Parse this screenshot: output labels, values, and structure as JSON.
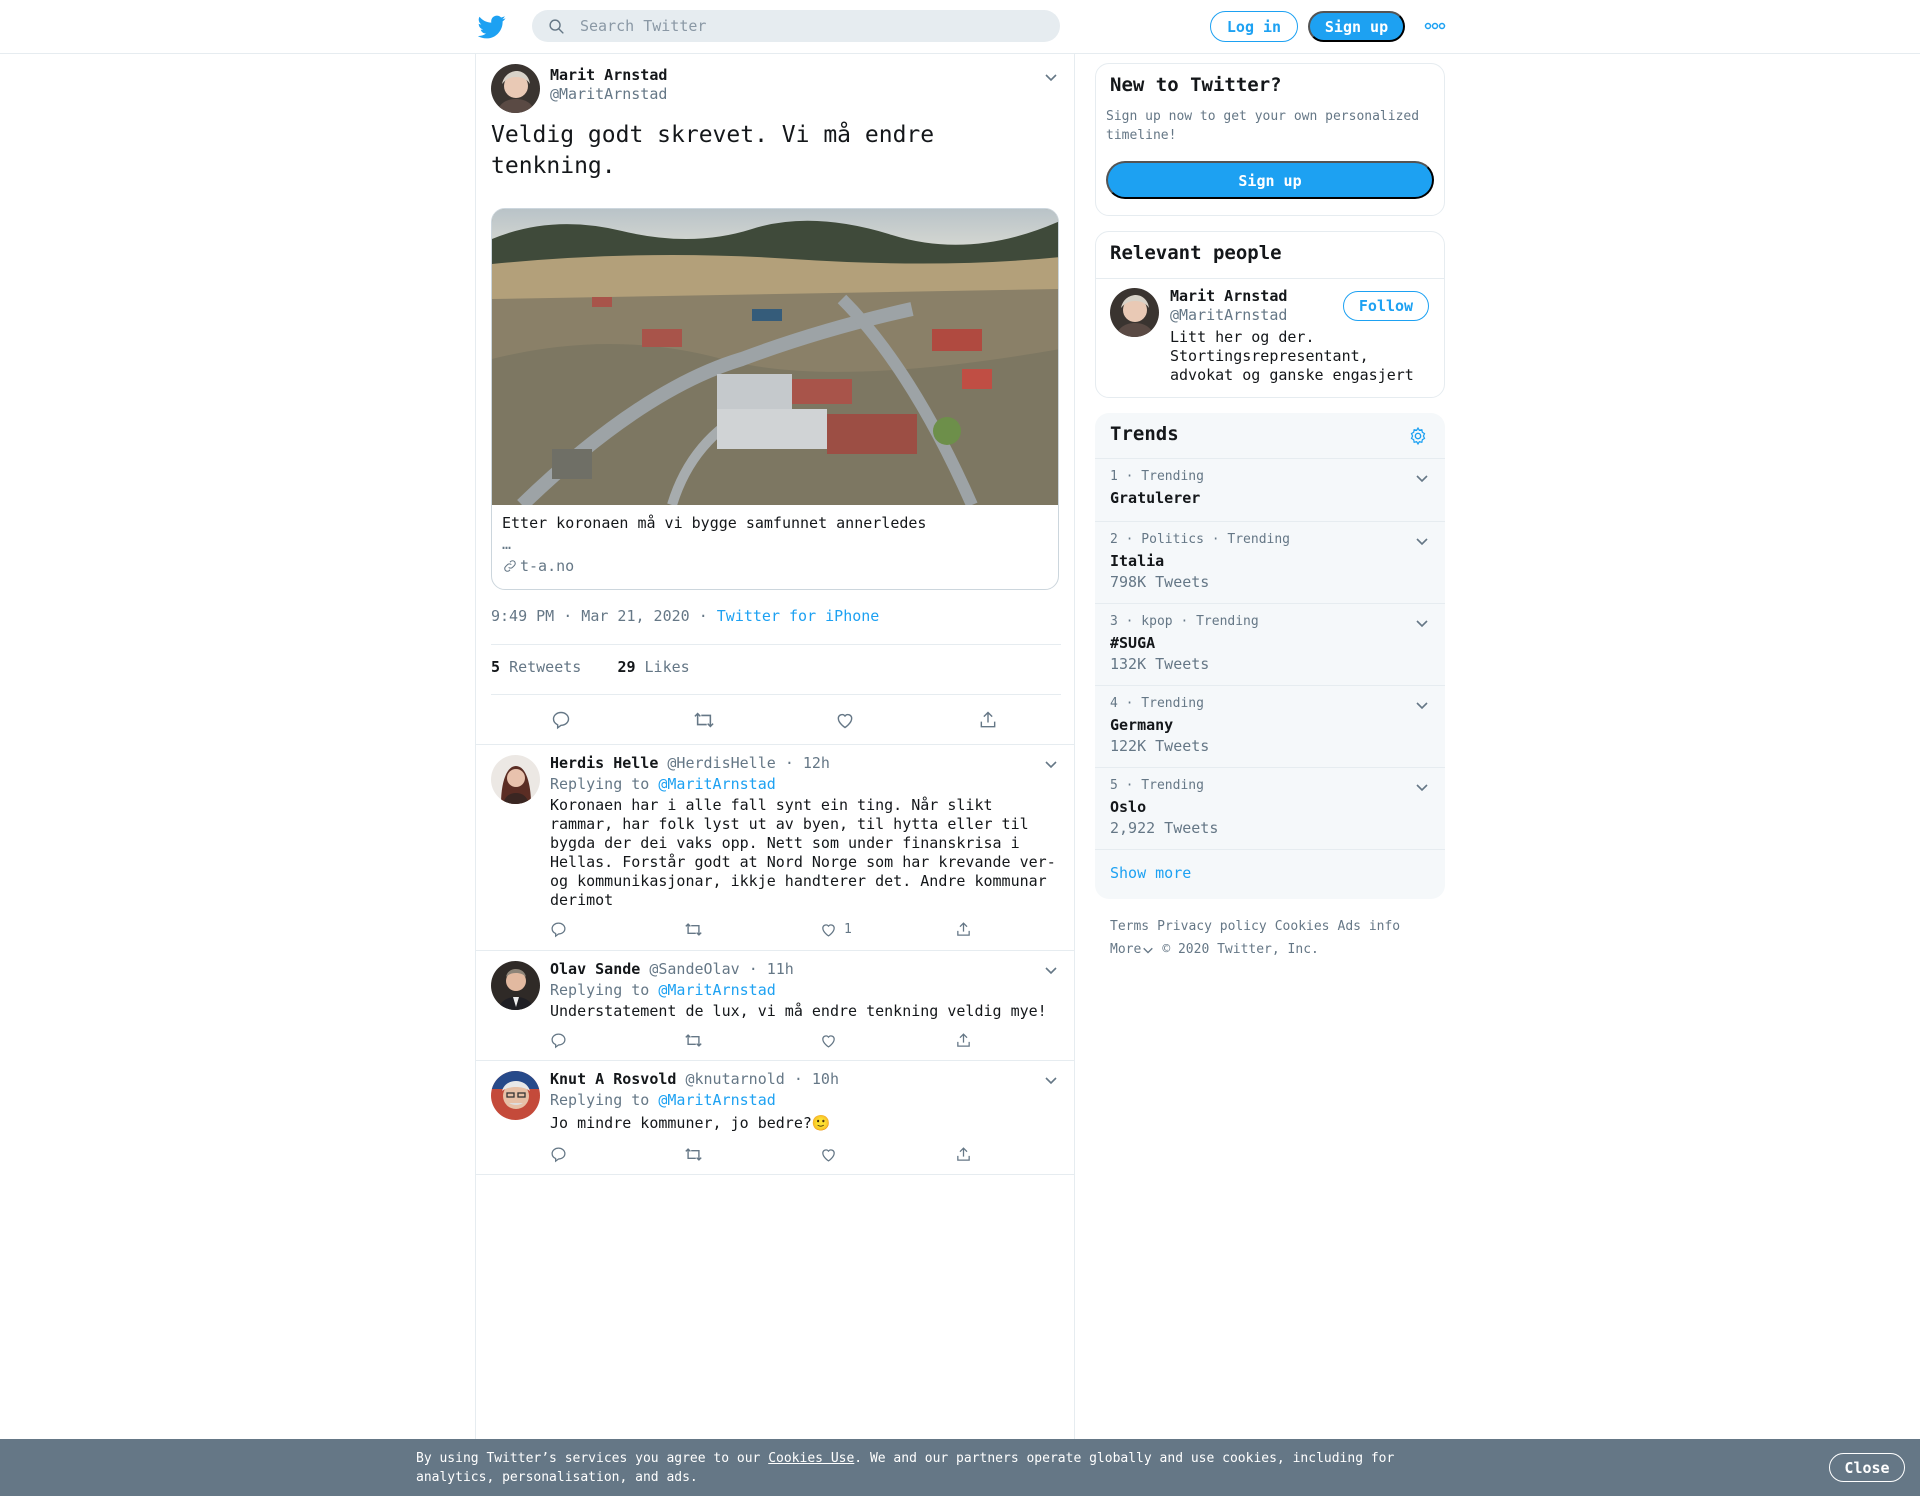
{
  "header": {
    "logo_icon": "twitter-bird-icon",
    "search_placeholder": "Search Twitter",
    "login_label": "Log in",
    "signup_label": "Sign up",
    "more_icon": "more-dots-icon"
  },
  "colors": {
    "accent": "#1da1f2",
    "text": "#14171a",
    "muted": "#657786",
    "border": "#e6ecf0",
    "cookie_bg": "#657786"
  },
  "tweet": {
    "author_name": "Marit Arnstad",
    "author_handle": "@MaritArnstad",
    "text": "Veldig godt skrevet. Vi må endre tenkning.",
    "card": {
      "title": "Etter koronaen må vi bygge samfunnet annerledes",
      "description": "…",
      "domain": "t-a.no"
    },
    "timestamp": "9:49 PM · Mar 21, 2020",
    "meta_sep": " · ",
    "source": "Twitter for iPhone",
    "retweet_count": "5",
    "retweet_label": "Retweets",
    "like_count": "29",
    "like_label": "Likes"
  },
  "replies": [
    {
      "name": "Herdis Helle",
      "handle": "@HerdisHelle",
      "time": "· 12h",
      "replying_label": "Replying to",
      "replying_to": "@MaritArnstad",
      "text": "Koronaen har i alle fall synt ein ting. Når slikt rammar, har folk lyst ut av byen, til hytta eller til bygda der dei vaks opp. Nett som under finanskrisa i Hellas. Forstår godt at Nord Norge som har krevande ver- og kommunikasjonar, ikkje handterer det. Andre kommunar derimot",
      "likes": "1"
    },
    {
      "name": "Olav Sande",
      "handle": "@SandeOlav",
      "time": "· 11h",
      "replying_label": "Replying to",
      "replying_to": "@MaritArnstad",
      "text": "Understatement de lux, vi må endre tenkning veldig mye!",
      "likes": ""
    },
    {
      "name": "Knut A Rosvold",
      "handle": "@knutarnold",
      "time": "· 10h",
      "replying_label": "Replying to",
      "replying_to": "@MaritArnstad",
      "text": "Jo mindre kommuner, jo bedre?🙂",
      "likes": ""
    }
  ],
  "sidebar": {
    "new_title": "New to Twitter?",
    "new_text": "Sign up now to get your own personalized timeline!",
    "new_signup": "Sign up",
    "relevant_title": "Relevant people",
    "person_name": "Marit Arnstad",
    "person_handle": "@MaritArnstad",
    "person_bio": "Litt her og der. Stortingsrepresentant, advokat og ganske engasjert",
    "follow_label": "Follow",
    "trends_title": "Trends",
    "trends": [
      {
        "meta": "1 · Trending",
        "name": "Gratulerer",
        "count": ""
      },
      {
        "meta": "2 · Politics · Trending",
        "name": "Italia",
        "count": "798K Tweets"
      },
      {
        "meta": "3 · kpop · Trending",
        "name": "#SUGA",
        "count": "132K Tweets"
      },
      {
        "meta": "4 · Trending",
        "name": "Germany",
        "count": "122K Tweets"
      },
      {
        "meta": "5 · Trending",
        "name": "Oslo",
        "count": "2,922 Tweets"
      }
    ],
    "show_more": "Show more"
  },
  "footer": {
    "terms": "Terms",
    "privacy": "Privacy policy",
    "cookies": "Cookies",
    "ads": "Ads info",
    "more": "More",
    "copyright": "© 2020 Twitter, Inc."
  },
  "cookie_bar": {
    "text_before": "By using Twitter’s services you agree to our ",
    "link": "Cookies Use",
    "text_after": ". We and our partners operate globally and use cookies, including for analytics, personalisation, and ads.",
    "close_label": "Close"
  }
}
